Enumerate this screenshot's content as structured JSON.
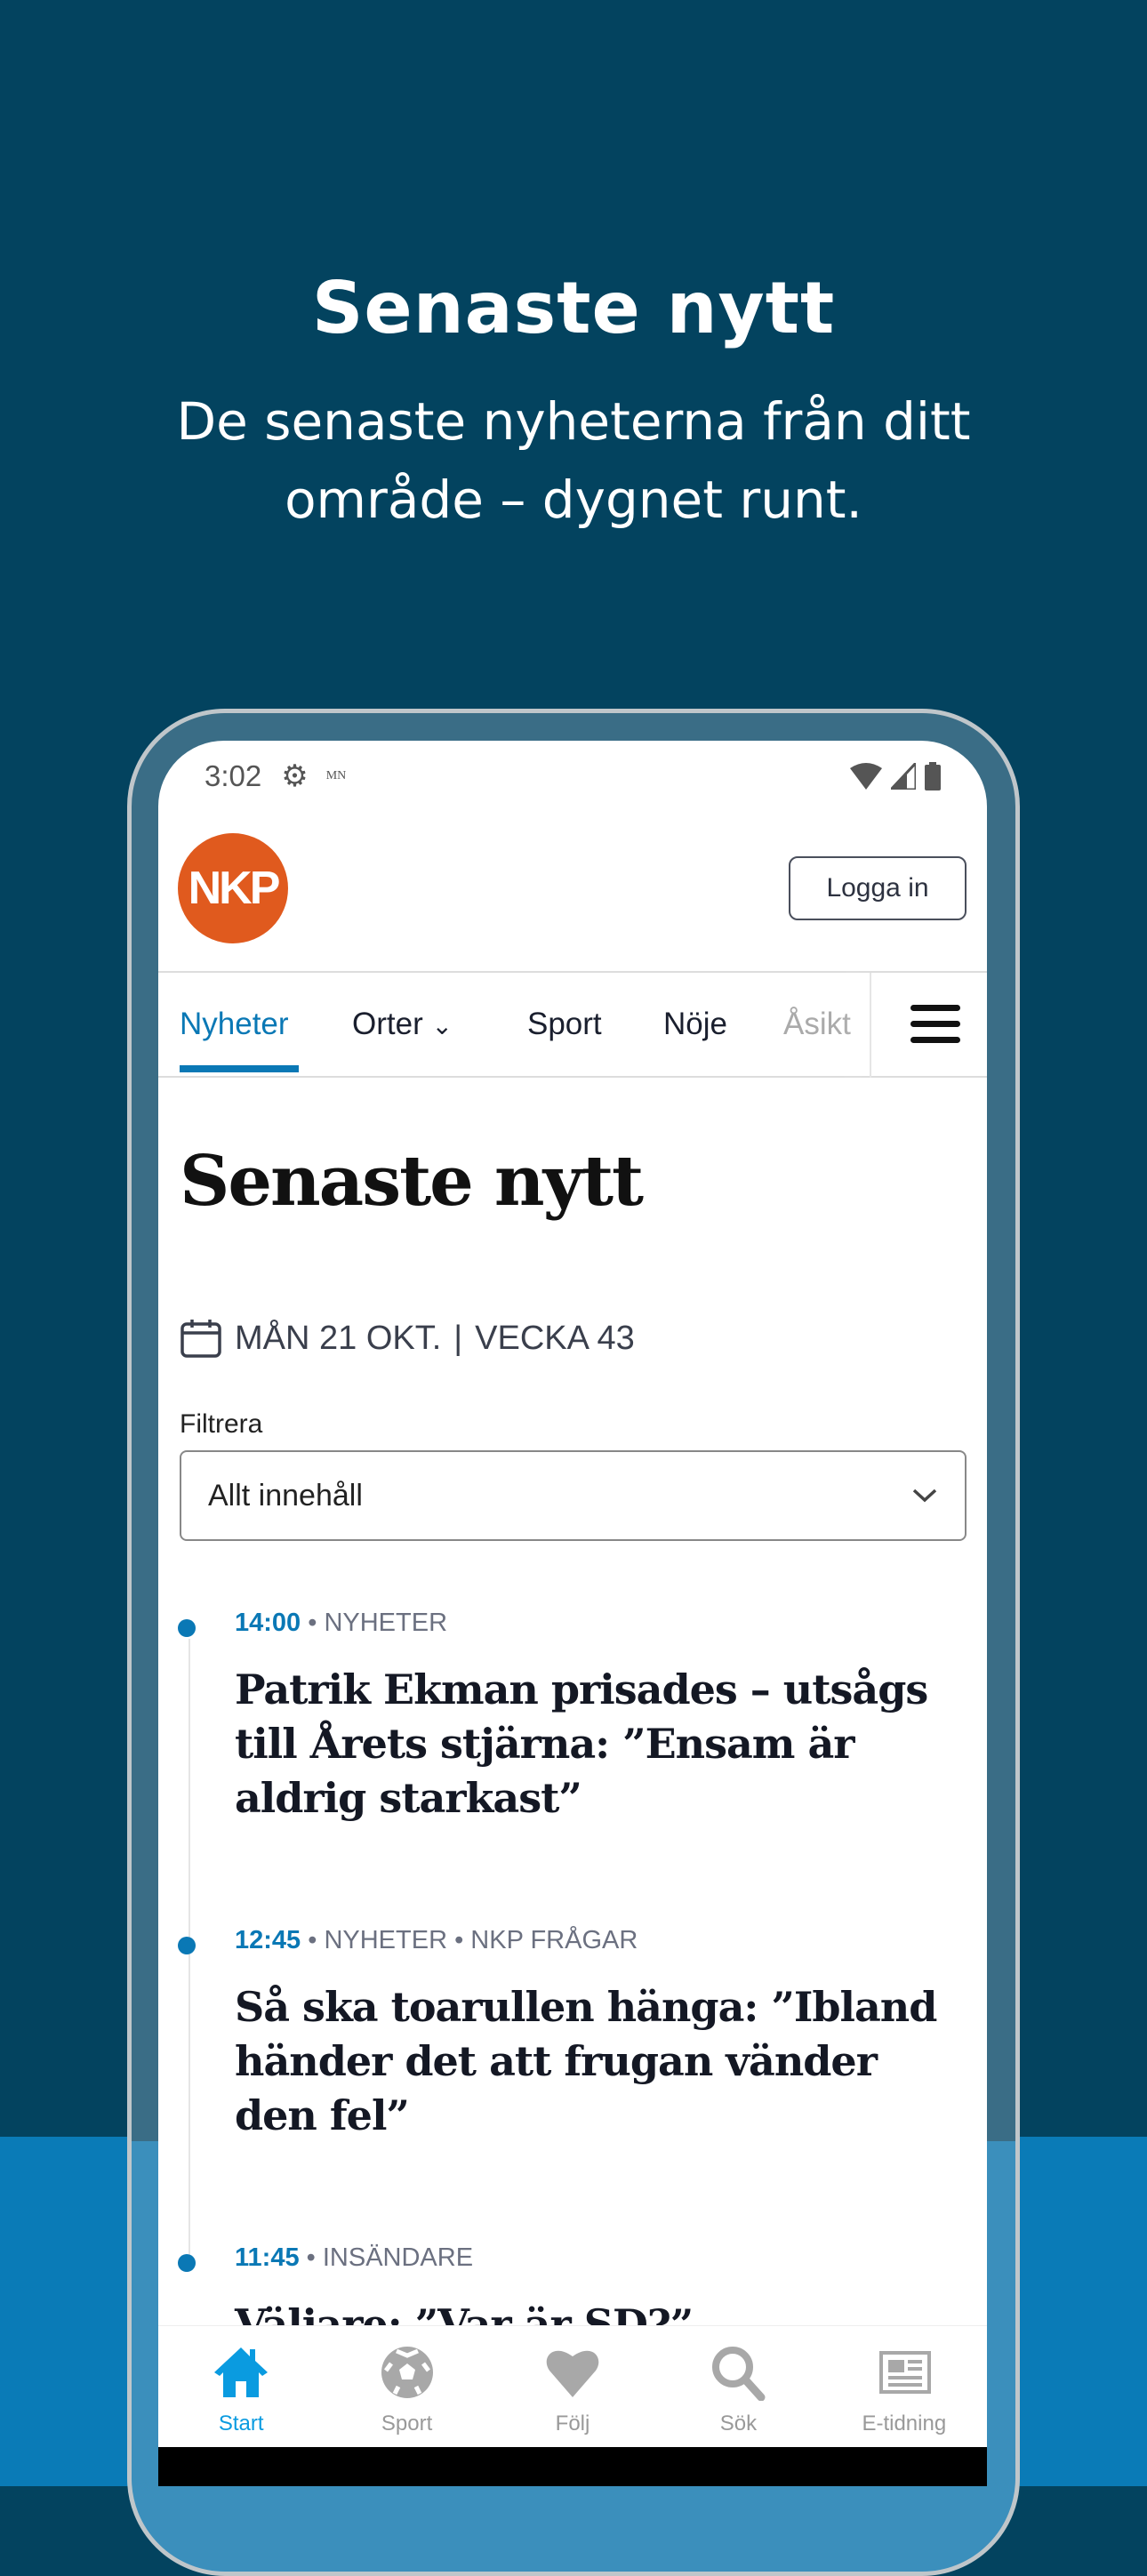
{
  "promo": {
    "title": "Senaste nytt",
    "subtitle_line1": "De senaste nyheterna från ditt",
    "subtitle_line2": "område – dygnet runt."
  },
  "status": {
    "time": "3:02",
    "carrier_label": "MN"
  },
  "header": {
    "logo": "NKP",
    "login": "Logga in"
  },
  "nav": {
    "items": [
      {
        "label": "Nyheter",
        "active": true
      },
      {
        "label": "Orter"
      },
      {
        "label": "Sport"
      },
      {
        "label": "Nöje"
      },
      {
        "label": "Åsikt"
      }
    ]
  },
  "page": {
    "title": "Senaste nytt",
    "date": "MÅN 21 OKT.",
    "separator": "|",
    "week": "VECKA 43",
    "filter_label": "Filtrera",
    "filter_value": "Allt innehåll"
  },
  "articles": [
    {
      "time": "14:00",
      "meta": "• NYHETER",
      "headline": "Patrik Ekman prisades – utsågs till Årets stjärna: ”Ensam är aldrig starkast”"
    },
    {
      "time": "12:45",
      "meta": "• NYHETER • NKP FRÅGAR",
      "headline": "Så ska toarullen hänga: ”Ibland händer det att frugan vänder den fel”"
    },
    {
      "time": "11:45",
      "meta": "• INSÄNDARE",
      "headline": "Väljare: ”Var är SD?”"
    }
  ],
  "tabbar": [
    {
      "label": "Start",
      "icon": "home-icon",
      "active": true
    },
    {
      "label": "Sport",
      "icon": "football-icon"
    },
    {
      "label": "Följ",
      "icon": "heart-icon"
    },
    {
      "label": "Sök",
      "icon": "search-icon"
    },
    {
      "label": "E-tidning",
      "icon": "newspaper-icon"
    }
  ],
  "colors": {
    "background": "#03435f",
    "accent": "#0a78b5",
    "logo": "#e05a1e",
    "band": "#0a7bb7"
  }
}
